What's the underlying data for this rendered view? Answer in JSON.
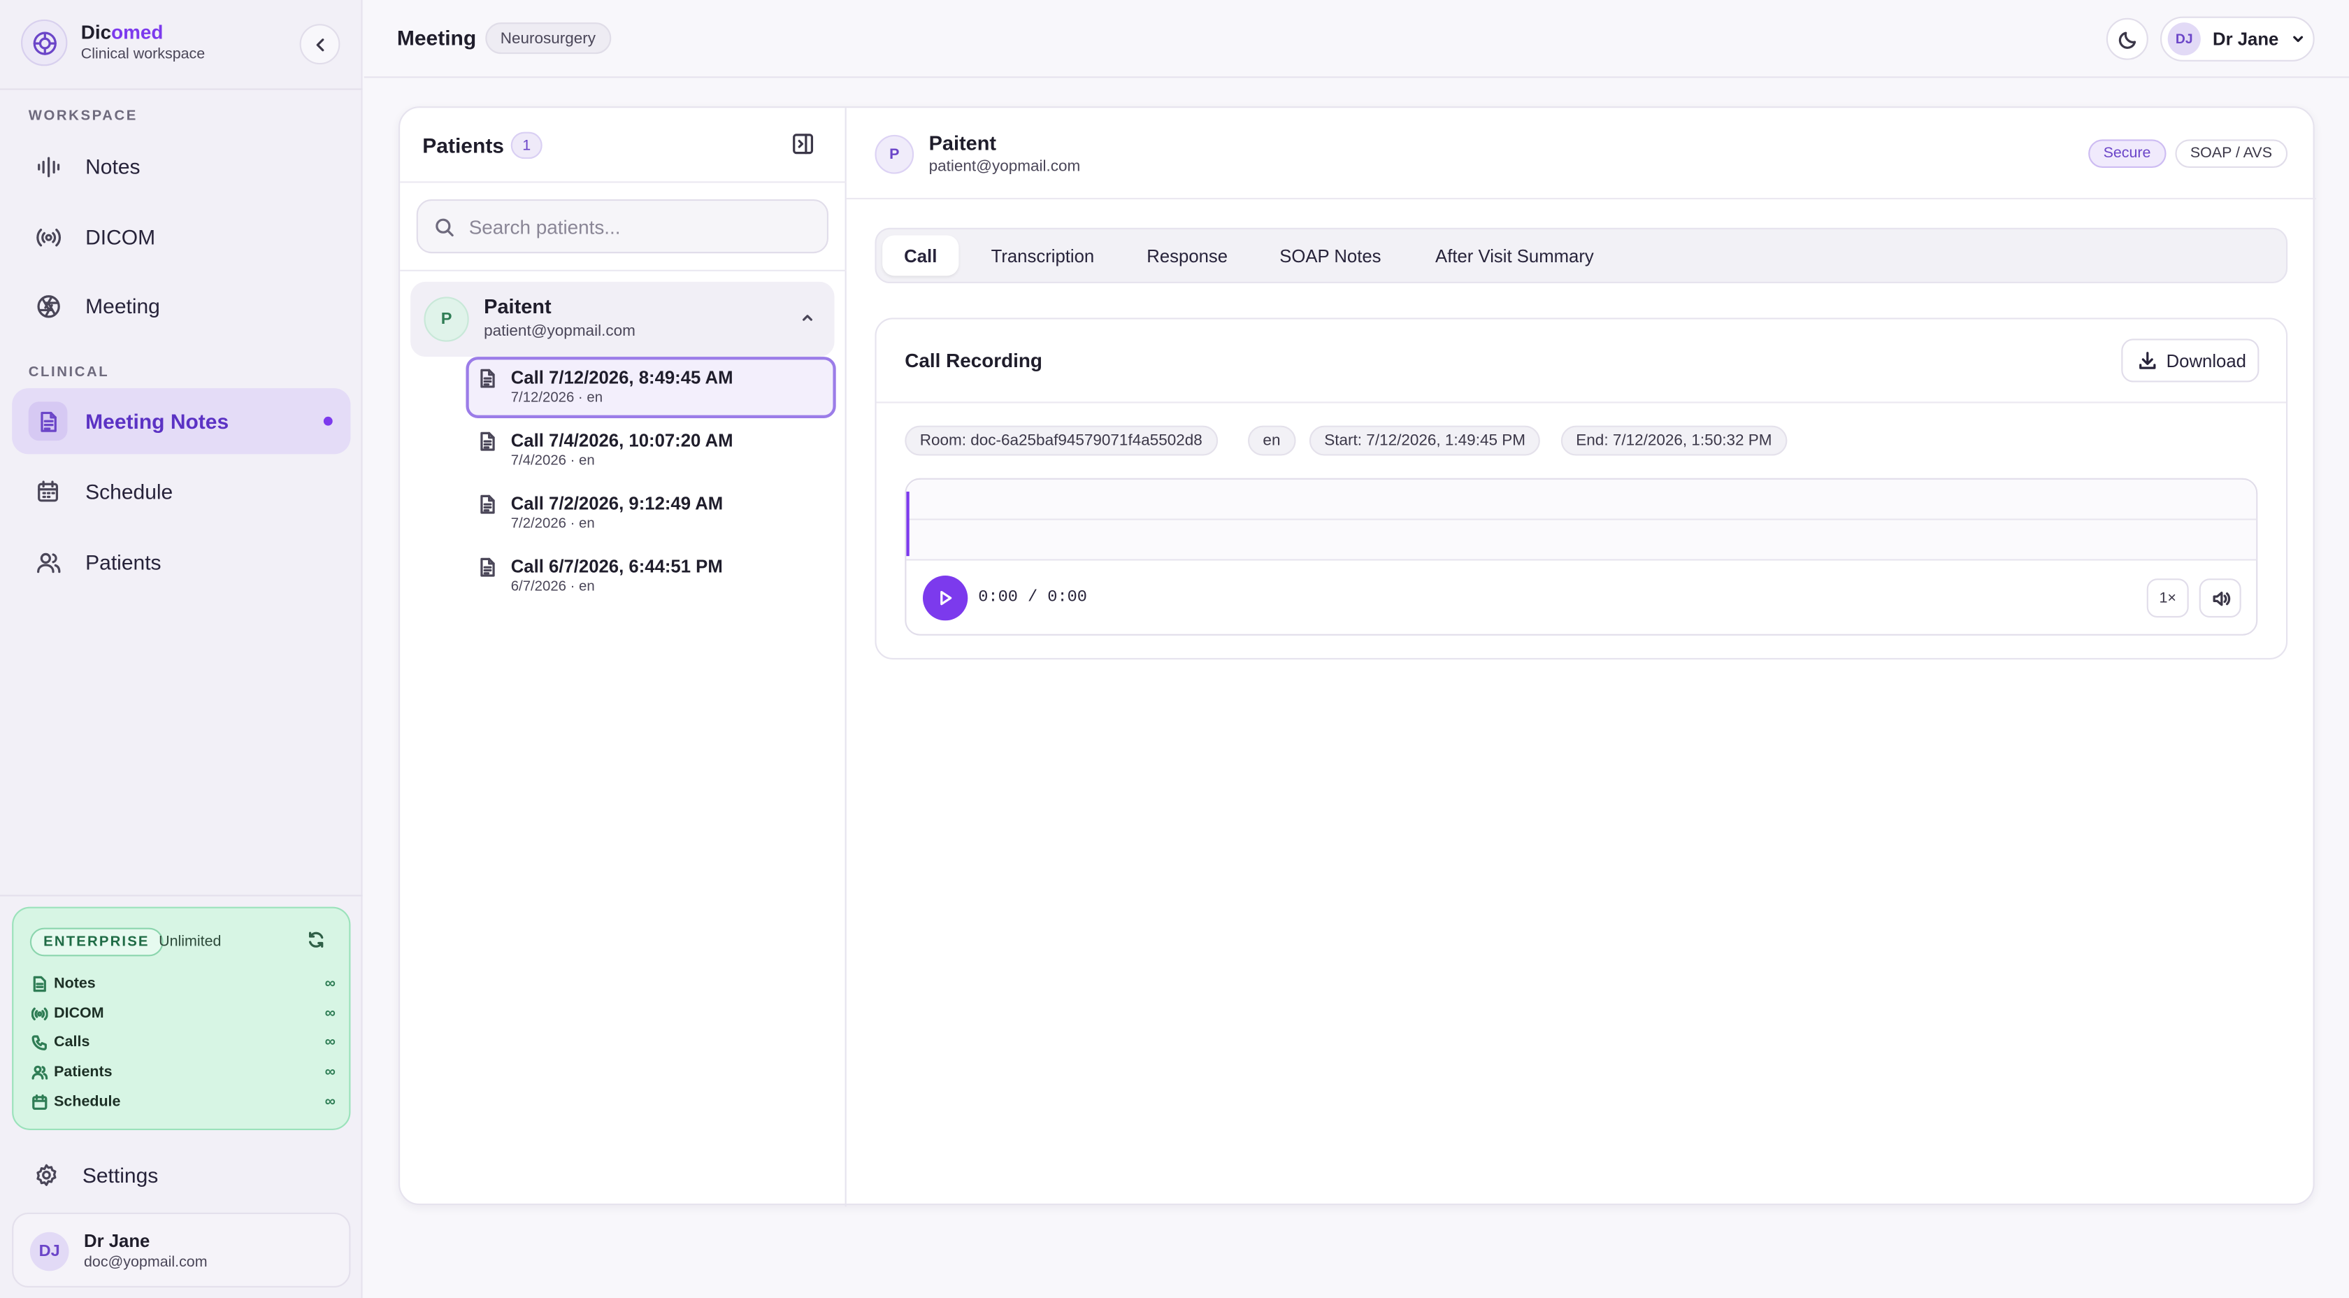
{
  "app": {
    "name_prefix": "Dic",
    "name_accent": "omed",
    "subtitle": "Clinical workspace"
  },
  "sidebar": {
    "workspace_label": "WORKSPACE",
    "clinical_label": "CLINICAL",
    "items": [
      {
        "label": "Notes",
        "icon": "waveform-icon"
      },
      {
        "label": "DICOM",
        "icon": "broadcast-icon"
      },
      {
        "label": "Meeting",
        "icon": "aperture-icon"
      },
      {
        "label": "Meeting Notes",
        "icon": "document-icon",
        "active": true
      },
      {
        "label": "Schedule",
        "icon": "calendar-icon"
      },
      {
        "label": "Patients",
        "icon": "users-icon"
      }
    ],
    "plan": {
      "badge": "ENTERPRISE",
      "tier": "Unlimited",
      "rows": [
        {
          "label": "Notes",
          "value": "∞"
        },
        {
          "label": "DICOM",
          "value": "∞"
        },
        {
          "label": "Calls",
          "value": "∞"
        },
        {
          "label": "Patients",
          "value": "∞"
        },
        {
          "label": "Schedule",
          "value": "∞"
        }
      ]
    },
    "settings_label": "Settings",
    "user": {
      "initials": "DJ",
      "name": "Dr Jane",
      "email": "doc@yopmail.com"
    }
  },
  "topbar": {
    "title": "Meeting",
    "department": "Neurosurgery",
    "user_initials": "DJ",
    "user_name": "Dr Jane"
  },
  "patients_panel": {
    "title": "Patients",
    "count": "1",
    "search_placeholder": "Search patients...",
    "patient": {
      "initial": "P",
      "name": "Paitent",
      "email": "patient@yopmail.com"
    },
    "calls": [
      {
        "title": "Call 7/12/2026, 8:49:45 AM",
        "sub": "7/12/2026 · en",
        "active": true
      },
      {
        "title": "Call 7/4/2026, 10:07:20 AM",
        "sub": "7/4/2026 · en"
      },
      {
        "title": "Call 7/2/2026, 9:12:49 AM",
        "sub": "7/2/2026 · en"
      },
      {
        "title": "Call 6/7/2026, 6:44:51 PM",
        "sub": "6/7/2026 · en"
      }
    ]
  },
  "detail": {
    "patient": {
      "initial": "P",
      "name": "Paitent",
      "email": "patient@yopmail.com"
    },
    "badges": {
      "secure": "Secure",
      "format": "SOAP / AVS"
    },
    "tabs": [
      "Call",
      "Transcription",
      "Response",
      "SOAP Notes",
      "After Visit Summary"
    ],
    "active_tab": "Call",
    "recording": {
      "title": "Call Recording",
      "download_label": "Download",
      "room": "Room: doc-6a25baf94579071f4a5502d8",
      "lang": "en",
      "start": "Start: 7/12/2026, 1:49:45 PM",
      "end": "End: 7/12/2026, 1:50:32 PM",
      "time": "0:00 / 0:00",
      "speed": "1×"
    }
  },
  "colors": {
    "accent": "#7c3aed",
    "plan_bg": "#d7f5e4",
    "active_nav_bg": "#e4dcf7"
  }
}
